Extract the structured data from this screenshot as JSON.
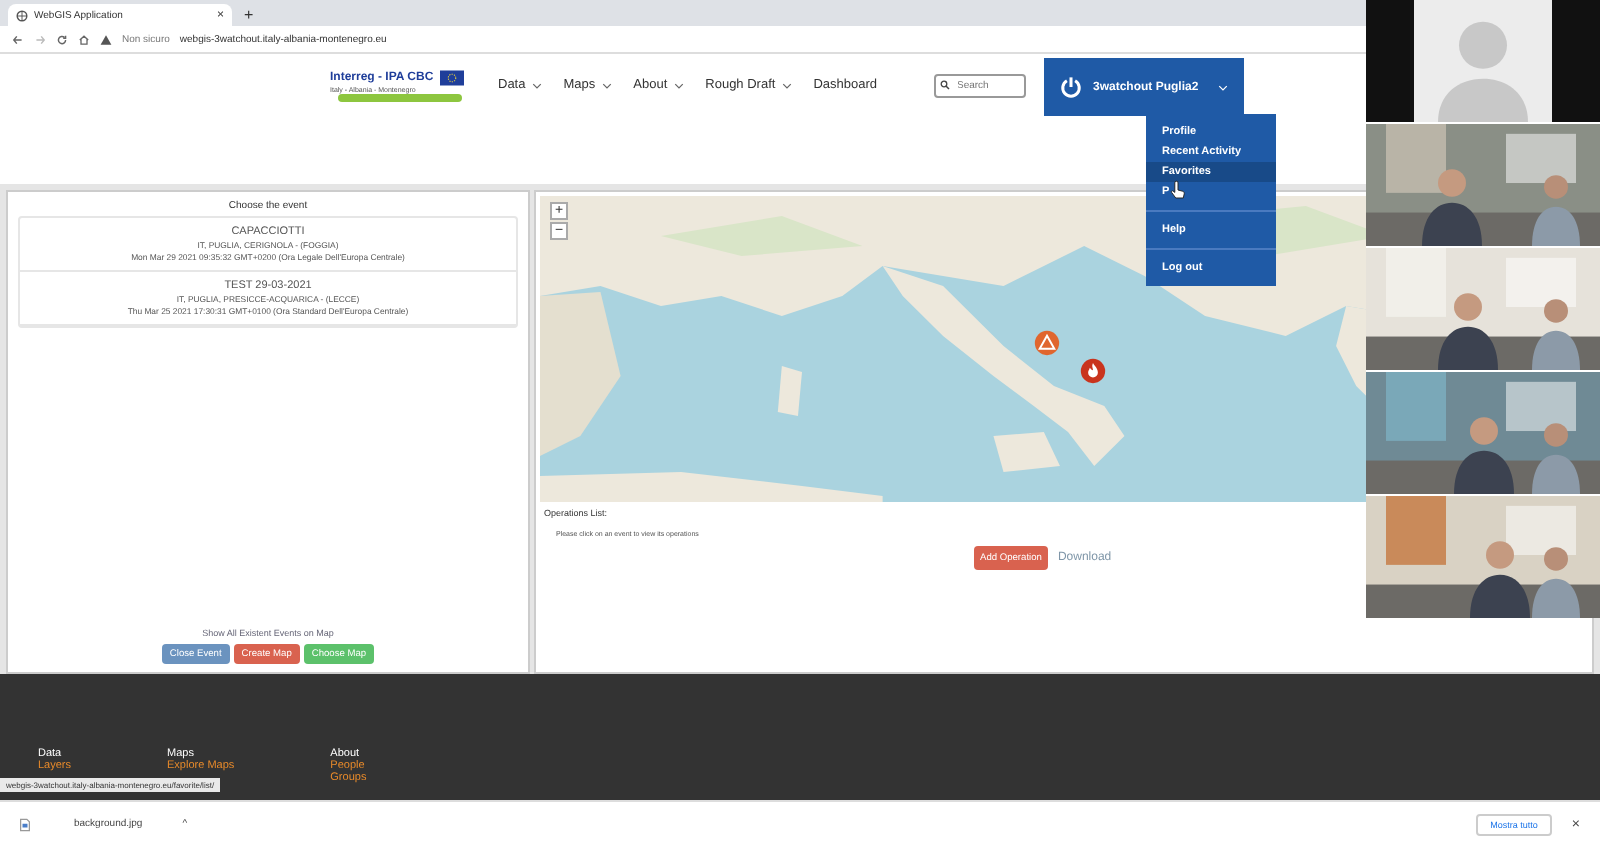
{
  "browser": {
    "tab": {
      "title": "WebGIS Application",
      "close": "×",
      "new_tab": "+"
    },
    "address": {
      "security": "Non sicuro",
      "url": "webgis-3watchout.italy-albania-montenegro.eu"
    }
  },
  "header": {
    "logo": {
      "title": "Interreg - IPA CBC",
      "subtitle": "Italy - Albania - Montenegro"
    },
    "nav": [
      {
        "label": "Data",
        "caret": true
      },
      {
        "label": "Maps",
        "caret": true
      },
      {
        "label": "About",
        "caret": true
      },
      {
        "label": "Rough Draft",
        "caret": true
      },
      {
        "label": "Dashboard",
        "caret": false
      }
    ],
    "search": {
      "placeholder": "Search"
    },
    "user": {
      "name": "3watchout Puglia2"
    }
  },
  "user_menu": [
    {
      "label": "Profile",
      "selected": false,
      "divider_after": false
    },
    {
      "label": "Recent Activity",
      "selected": false,
      "divider_after": false
    },
    {
      "label": "Favorites",
      "selected": true,
      "divider_after": false
    },
    {
      "label": "P",
      "selected": false,
      "divider_after": true
    },
    {
      "label": "Help",
      "selected": false,
      "divider_after": true
    },
    {
      "label": "Log out",
      "selected": false,
      "divider_after": false
    }
  ],
  "events_panel": {
    "title": "Choose the event",
    "events": [
      {
        "name": "CAPACCIOTTI",
        "place": "IT, PUGLIA, CERIGNOLA - (FOGGIA)",
        "date": "Mon Mar 29 2021 09:35:32 GMT+0200 (Ora Legale Dell'Europa Centrale)"
      },
      {
        "name": "TEST 29-03-2021",
        "place": "IT, PUGLIA, PRESICCE-ACQUARICA - (LECCE)",
        "date": "Thu Mar 25 2021 17:30:31 GMT+0100 (Ora Standard Dell'Europa Centrale)"
      }
    ],
    "show_all": "Show All Existent Events on Map",
    "buttons": [
      {
        "label": "Close Event",
        "kind": "info"
      },
      {
        "label": "Create Map",
        "kind": "danger"
      },
      {
        "label": "Choose Map",
        "kind": "success"
      }
    ]
  },
  "map": {
    "zoom_in": "+",
    "zoom_out": "−",
    "markers": [
      {
        "kind": "warning"
      },
      {
        "kind": "fire"
      }
    ]
  },
  "operations": {
    "title": "Operations List:",
    "hint": "Please click on an event to view its operations",
    "add": "Add Operation",
    "download": "Download"
  },
  "footer": [
    {
      "heading": "Data",
      "links": [
        "Layers"
      ]
    },
    {
      "heading": "Maps",
      "links": [
        "Explore Maps"
      ]
    },
    {
      "heading": "About",
      "links": [
        "People",
        "Groups"
      ]
    }
  ],
  "status_url": "webgis-3watchout.italy-albania-montenegro.eu/favorite/list/",
  "download_bar": {
    "file": "background.jpg",
    "caret": "^",
    "show_all": "Mostra tutto",
    "close": "×"
  },
  "video_tiles": [
    {
      "kind": "avatar"
    },
    {
      "kind": "picture"
    },
    {
      "kind": "picture"
    },
    {
      "kind": "picture"
    },
    {
      "kind": "picture"
    }
  ]
}
